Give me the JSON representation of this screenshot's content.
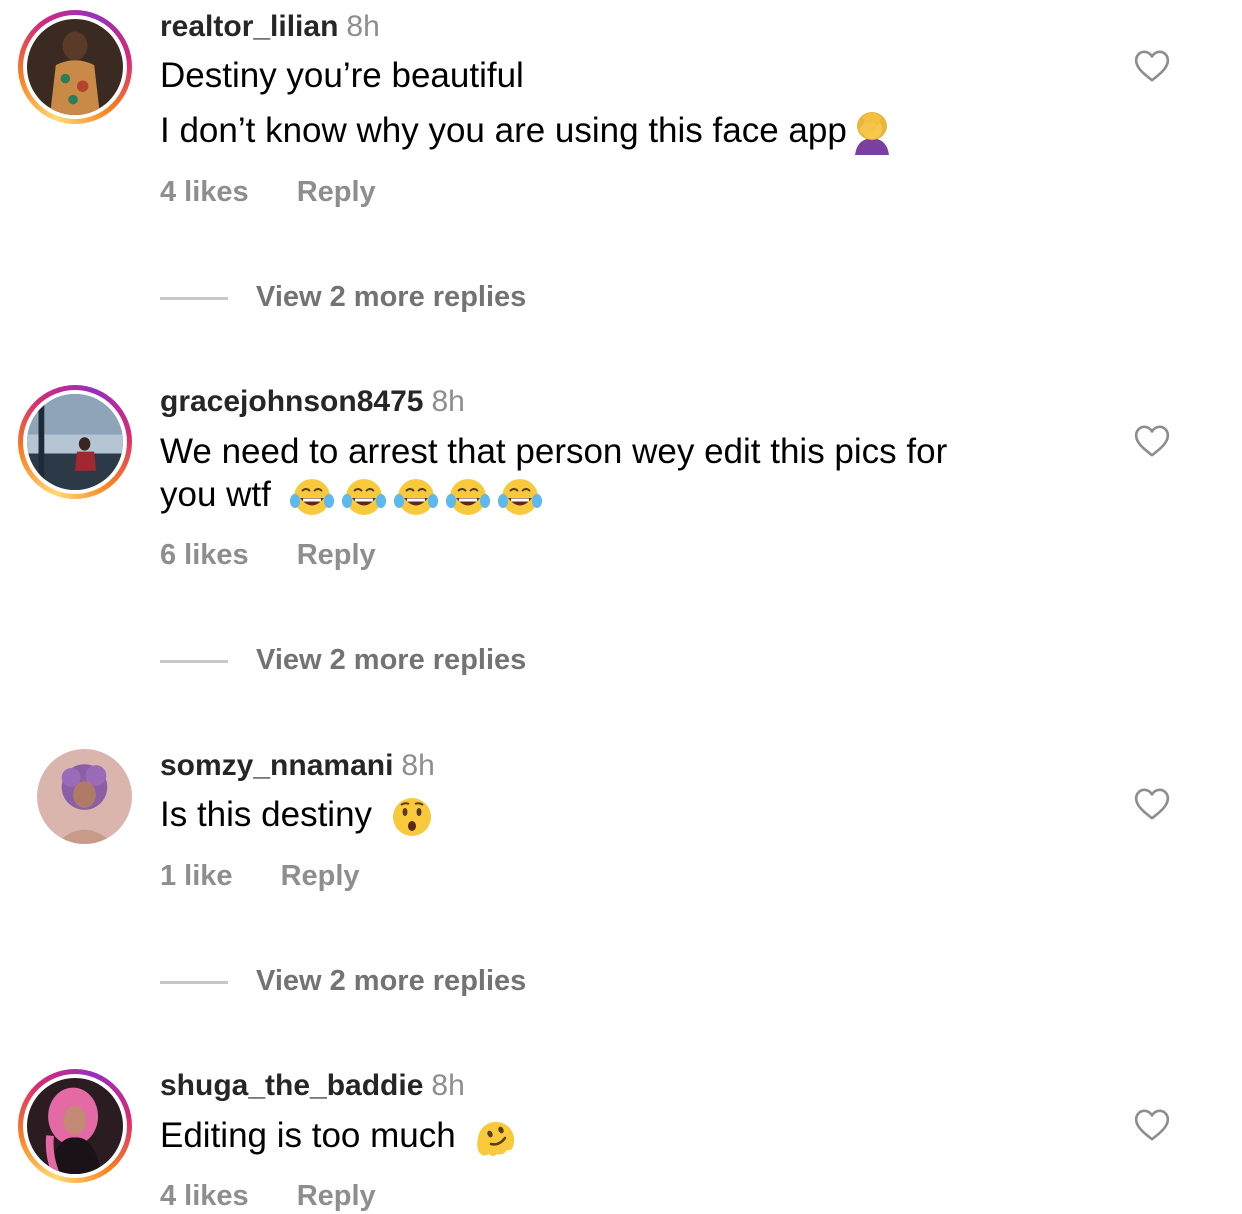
{
  "comments": [
    {
      "username": "realtor_lilian",
      "time": "8h",
      "lines": [
        "Destiny you’re beautiful",
        "I don’t know why you are using this face app"
      ],
      "emoji": "woman-facepalming",
      "likes": "4 likes",
      "reply": "Reply",
      "view_more": "View 2 more replies"
    },
    {
      "username": "gracejohnson8475",
      "time": "8h",
      "lines": [
        "We need to arrest that person wey edit this pics for",
        "you wtf"
      ],
      "emoji": "face-with-tears-of-joy x5",
      "likes": "6 likes",
      "reply": "Reply",
      "view_more": "View 2 more replies"
    },
    {
      "username": "somzy_nnamani",
      "time": "8h",
      "lines": [
        "Is this destiny"
      ],
      "emoji": "hushed-face",
      "likes": "1 like",
      "reply": "Reply",
      "view_more": "View 2 more replies"
    },
    {
      "username": "shuga_the_baddie",
      "time": "8h",
      "lines": [
        "Editing is too much"
      ],
      "emoji": "melting-face",
      "likes": "4 likes",
      "reply": "Reply"
    }
  ],
  "icons": {
    "like": "heart-outline-icon"
  },
  "colors": {
    "text": "#000000",
    "username": "#262626",
    "muted": "#8e8e8e",
    "story_ring_start": "#feda75",
    "story_ring_end": "#962fbf"
  }
}
